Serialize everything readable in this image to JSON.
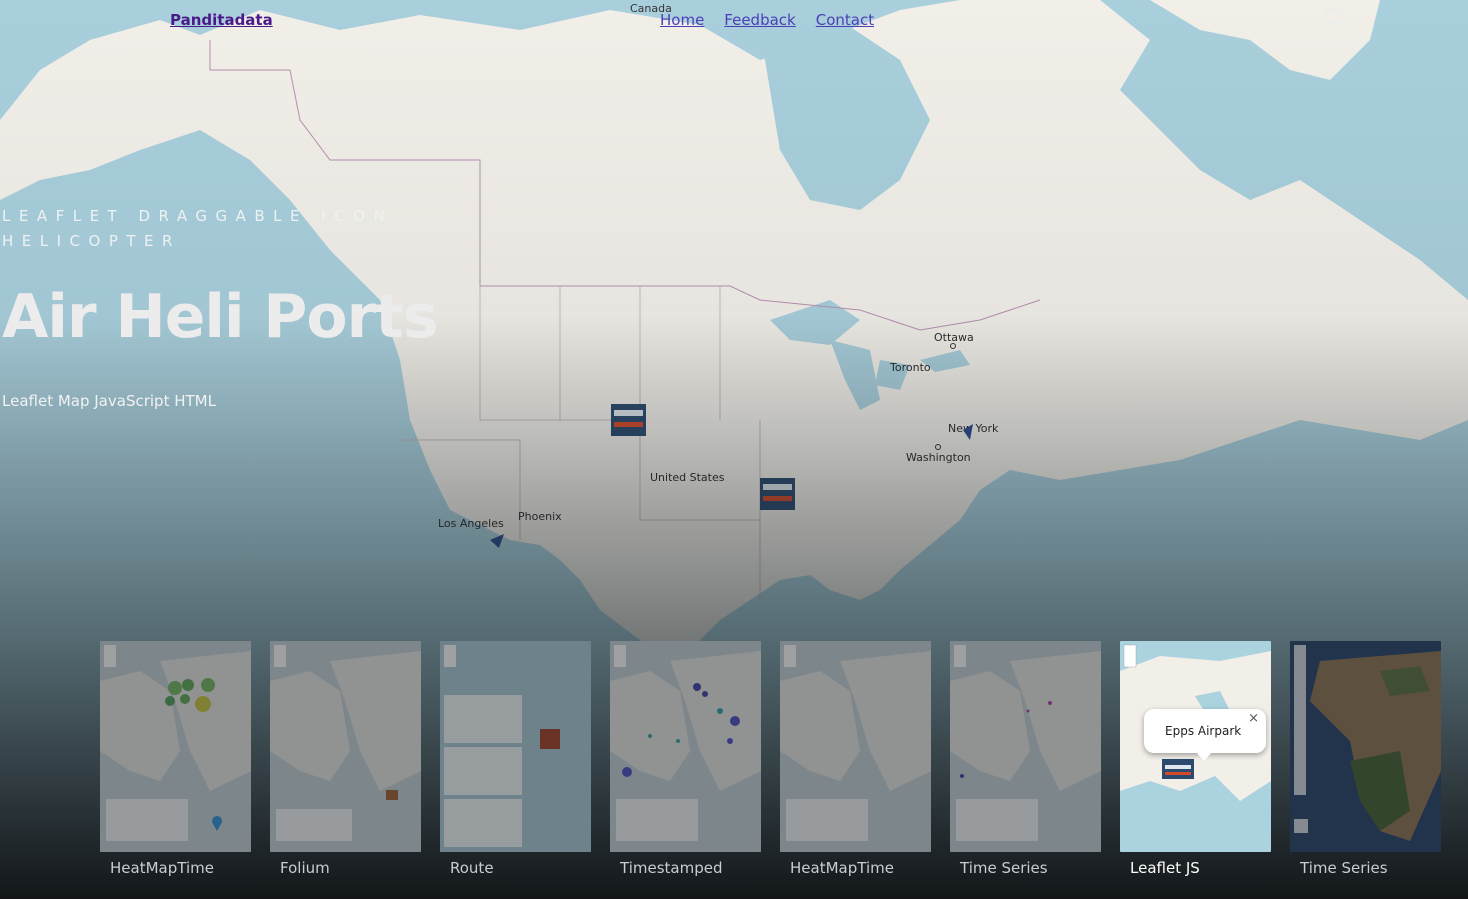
{
  "header": {
    "brand": "Panditadata",
    "nav": [
      "Home",
      "Feedback",
      "Contact"
    ]
  },
  "hero": {
    "eyebrow": "LEAFLET DRAGGABLE ICON HELICOPTER",
    "title": "Air Heli Ports",
    "subtitle": "Leaflet Map JavaScript HTML"
  },
  "map": {
    "labels": {
      "canada": "Canada",
      "united_states": "United States",
      "ottawa": "Ottawa",
      "toronto": "Toronto",
      "new_york": "New York",
      "washington": "Washington",
      "phoenix": "Phoenix",
      "los_angeles": "Los Angeles"
    },
    "colors": {
      "water": "#a9cfdc",
      "land": "#f2efe9"
    }
  },
  "gallery": [
    {
      "label": "HeatMapTime",
      "icon": "heatmap-thumbnail"
    },
    {
      "label": "Folium",
      "icon": "folium-thumbnail"
    },
    {
      "label": "Route",
      "icon": "route-thumbnail"
    },
    {
      "label": "Timestamped",
      "icon": "timestamped-thumbnail"
    },
    {
      "label": "HeatMapTime",
      "icon": "heatmap-thumbnail"
    },
    {
      "label": "Time Series",
      "icon": "time-series-thumbnail"
    },
    {
      "label": "Leaflet JS",
      "icon": "leaflet-js-thumbnail",
      "active": true,
      "popup": "Epps Airpark",
      "close": "×"
    },
    {
      "label": "Time Series",
      "icon": "satellite-thumbnail"
    }
  ]
}
